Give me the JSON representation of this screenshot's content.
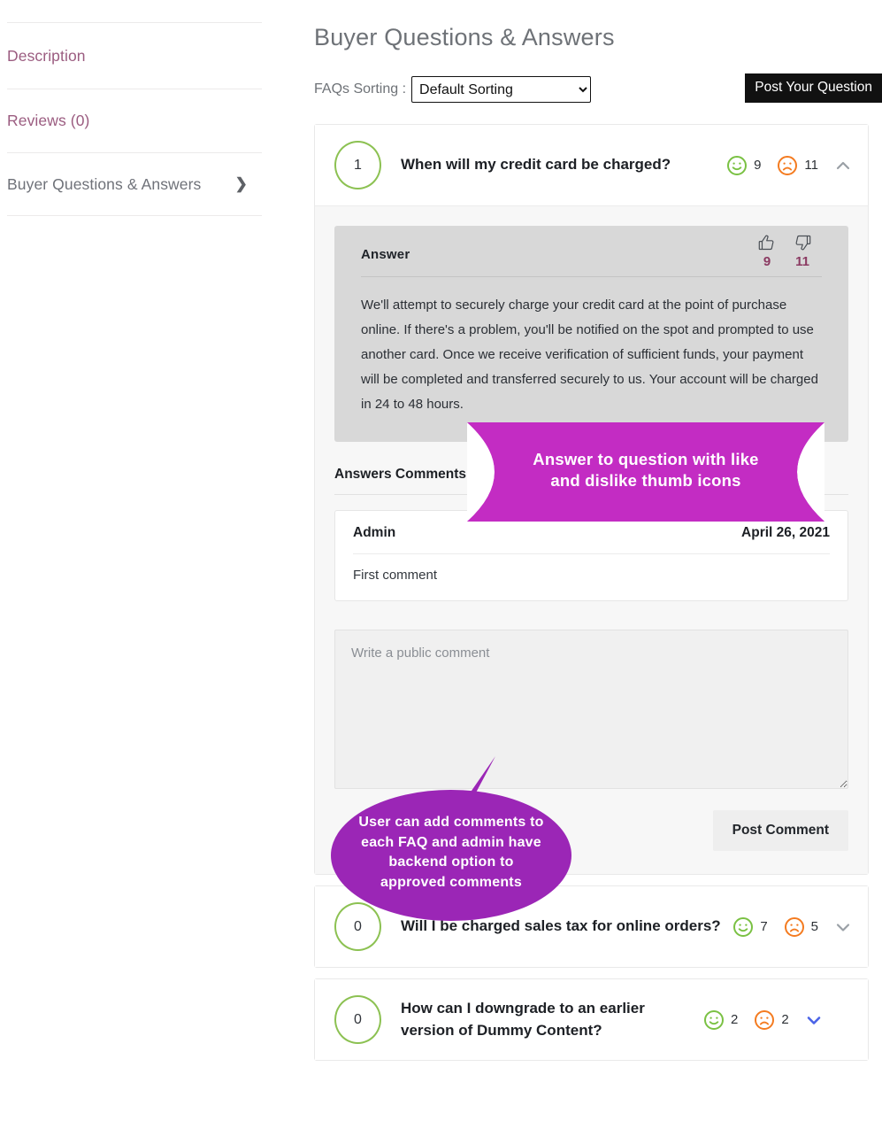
{
  "sidebar": {
    "items": [
      {
        "label": "Description",
        "icon": null,
        "active": false
      },
      {
        "label": "Reviews (0)",
        "icon": null,
        "active": false
      },
      {
        "label": "Buyer Questions & Answers",
        "icon": "chevron-right-icon",
        "active": true
      }
    ],
    "chevron_glyph": "❯"
  },
  "main": {
    "title": "Buyer Questions & Answers",
    "sorting": {
      "label": "FAQs Sorting :",
      "selected": "Default Sorting",
      "options": [
        "Default Sorting"
      ]
    },
    "post_question_label": "Post Your Question"
  },
  "faqs": [
    {
      "index": "1",
      "question": "When will my credit card be charged?",
      "like_count": "9",
      "dislike_count": "11",
      "expanded": true,
      "chevron": "chevron-up-icon",
      "chevron_color": "#9aa0a6",
      "answer": {
        "label": "Answer",
        "thumb_up_count": "9",
        "thumb_down_count": "11",
        "text": "We'll attempt to securely charge your credit card at the point of purchase online. If there's a problem, you'll be notified on the spot and prompted to use another card. Once we receive verification of sufficient funds, your payment will be completed and transferred securely to us. Your account will be charged in 24 to 48 hours."
      },
      "comments_title": "Answers Comments:",
      "comments": [
        {
          "author": "Admin",
          "date": "April 26, 2021",
          "body": "First comment"
        }
      ],
      "comment_placeholder": "Write a public comment",
      "comment_value": "",
      "post_comment_label": "Post Comment"
    },
    {
      "index": "0",
      "question": "Will I be charged sales tax for online orders?",
      "like_count": "7",
      "dislike_count": "5",
      "expanded": false,
      "chevron": "chevron-down-icon",
      "chevron_color": "#9aa0a6"
    },
    {
      "index": "0",
      "question": "How can I downgrade to an earlier version of Dummy Content?",
      "like_count": "2",
      "dislike_count": "2",
      "expanded": false,
      "chevron": "chevron-down-icon",
      "chevron_color": "#4a63e7"
    }
  ],
  "callouts": [
    {
      "shape": "banner",
      "line1": "Answer to question with like",
      "line2": "and dislike thumb icons",
      "color": "#c32cc3"
    },
    {
      "shape": "speech-bubble",
      "line1": "User can add comments to",
      "line2": "each FAQ and admin have",
      "line3": "backend option to",
      "line4": "approved comments",
      "color": "#9b26b6"
    }
  ],
  "colors": {
    "smiley_green": "#7ac143",
    "frown_orange": "#f47b20",
    "badge_green": "#8cc152",
    "thumb_count_purple": "#8b3a62",
    "sidebar_link": "#9b5c80",
    "callout_magenta": "#c32cc3",
    "callout_purple": "#9b26b6",
    "button_black": "#111111"
  }
}
